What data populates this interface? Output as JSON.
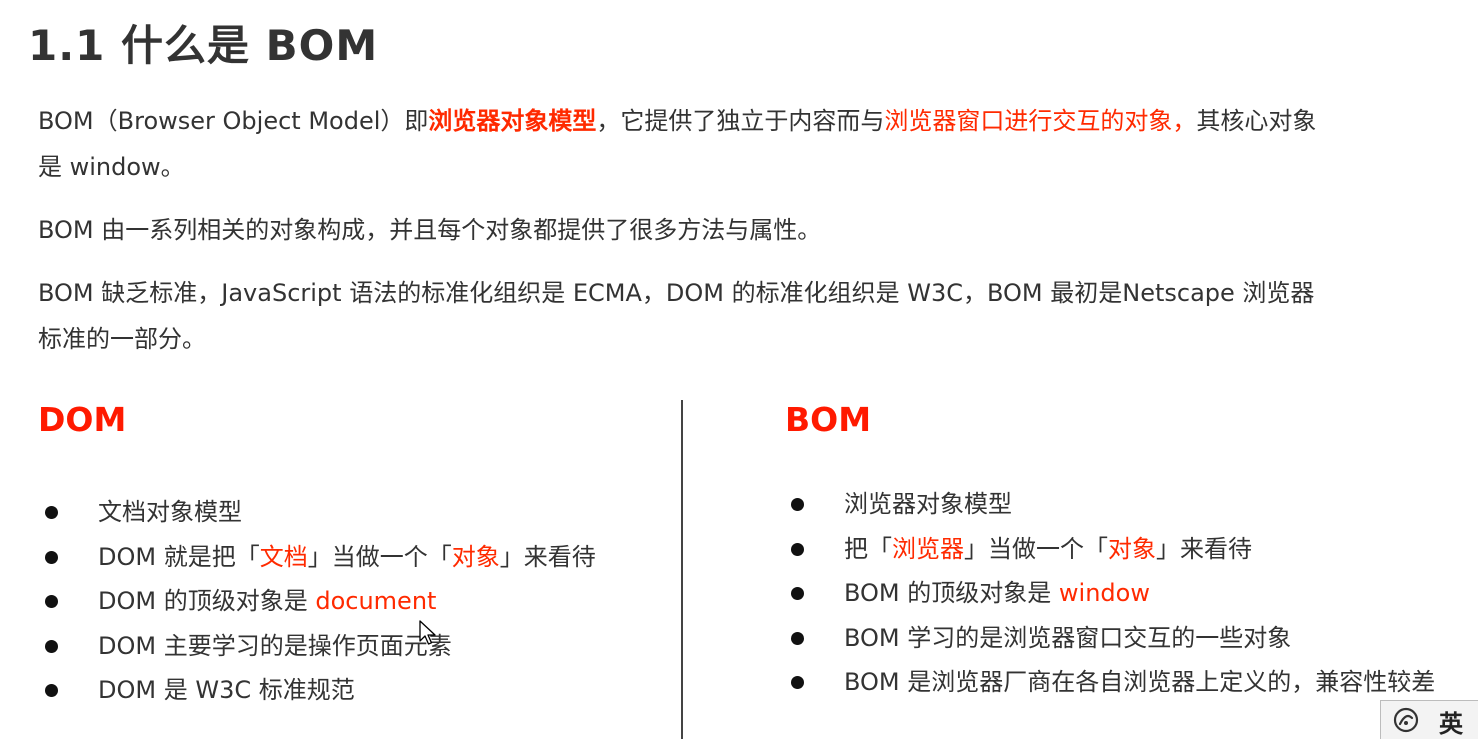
{
  "title": "1.1 什么是 BOM",
  "intro": {
    "p1_a": "BOM（Browser Object Model）即",
    "p1_b": "浏览器对象模型",
    "p1_c": "，它提供了独立于内容而与",
    "p1_d": "浏览器窗口进行交互的对象，",
    "p1_e": "其核心对象是 window。",
    "p2": "BOM 由一系列相关的对象构成，并且每个对象都提供了很多方法与属性。",
    "p3": "BOM 缺乏标准，JavaScript 语法的标准化组织是 ECMA，DOM 的标准化组织是 W3C，BOM 最初是Netscape 浏览器标准的一部分。"
  },
  "dom": {
    "heading": "DOM",
    "item1": "文档对象模型",
    "item2_a": "DOM 就是把「",
    "item2_b": "文档",
    "item2_c": "」当做一个「",
    "item2_d": "对象",
    "item2_e": "」来看待",
    "item3_a": "DOM 的顶级对象是 ",
    "item3_b": "document",
    "item4": "DOM 主要学习的是操作页面元素",
    "item5": "DOM 是 W3C 标准规范"
  },
  "bom": {
    "heading": "BOM",
    "item1": "浏览器对象模型",
    "item2_a": "把「",
    "item2_b": "浏览器",
    "item2_c": "」当做一个「",
    "item2_d": "对象",
    "item2_e": "」来看待",
    "item3_a": "BOM 的顶级对象是 ",
    "item3_b": "window",
    "item4": "BOM 学习的是浏览器窗口交互的一些对象",
    "item5": "BOM 是浏览器厂商在各自浏览器上定义的，兼容性较差"
  },
  "ime": {
    "icon": "ime-status-icon",
    "label": "英"
  },
  "colors": {
    "highlight": "#ff2a00",
    "text": "#333333"
  }
}
